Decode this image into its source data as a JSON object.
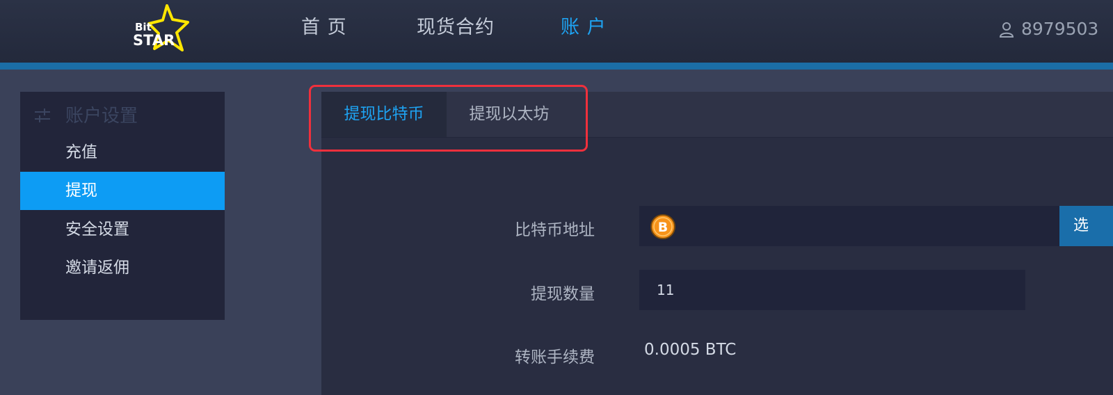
{
  "header": {
    "logo": {
      "word1": "Bit",
      "word2": "STAR",
      "star_color": "#ffe600"
    },
    "nav": [
      {
        "label": "首 页",
        "active": false
      },
      {
        "label": "现货合约",
        "active": false
      },
      {
        "label": "账 户",
        "active": true
      }
    ],
    "user": {
      "icon": "user-icon",
      "id_text": "8979503"
    }
  },
  "sidebar": {
    "heading": {
      "icon": "sliders-icon",
      "label": "账户设置"
    },
    "items": [
      {
        "label": "充值",
        "active": false
      },
      {
        "label": "提现",
        "active": true
      },
      {
        "label": "安全设置",
        "active": false
      },
      {
        "label": "邀请返佣",
        "active": false
      }
    ]
  },
  "tabs": [
    {
      "label": "提现比特币",
      "active": true
    },
    {
      "label": "提现以太坊",
      "active": false
    }
  ],
  "form": {
    "address": {
      "label": "比特币地址",
      "icon": "bitcoin-icon",
      "value": "",
      "select_label": "选"
    },
    "amount": {
      "label": "提现数量",
      "value": "11"
    },
    "fee": {
      "label": "转账手续费",
      "value": "0.0005 BTC"
    }
  },
  "colors": {
    "accent": "#1ea3f2",
    "sidebar_active": "#0d9cf4",
    "highlight": "#f0303c",
    "header_line": "#1b6ea6",
    "bitcoin": "#f7931a"
  }
}
